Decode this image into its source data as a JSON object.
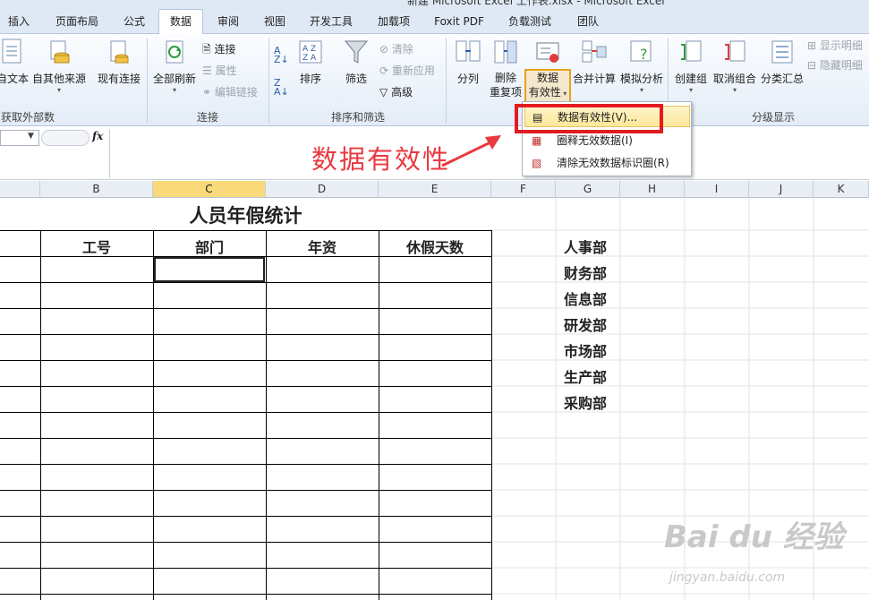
{
  "window": {
    "title": "新建 Microsoft Excel 工作表.xlsx - Microsoft Excel"
  },
  "tabs": [
    {
      "label": "插入"
    },
    {
      "label": "页面布局"
    },
    {
      "label": "公式"
    },
    {
      "label": "数据"
    },
    {
      "label": "审阅"
    },
    {
      "label": "视图"
    },
    {
      "label": "开发工具"
    },
    {
      "label": "加载项"
    },
    {
      "label": "Foxit PDF"
    },
    {
      "label": "负载测试"
    },
    {
      "label": "团队"
    }
  ],
  "ribbon": {
    "get_external": {
      "from_text": "自文本",
      "other_sources": "自其他来源",
      "existing": "现有连接",
      "group": "获取外部数据"
    },
    "connections": {
      "refresh_all": "全部刷新",
      "connections": "连接",
      "properties": "属性",
      "edit_links": "编辑链接",
      "group": "连接"
    },
    "sort_filter": {
      "sort": "排序",
      "filter": "筛选",
      "clear": "清除",
      "reapply": "重新应用",
      "advanced": "高级",
      "group": "排序和筛选"
    },
    "data_tools": {
      "text_to_columns": "分列",
      "remove_duplicates_1": "删除",
      "remove_duplicates_2": "重复项",
      "validation_1": "数据",
      "validation_2": "有效性",
      "consolidate": "合并计算",
      "what_if": "模拟分析"
    },
    "outline": {
      "group_btn": "创建组",
      "ungroup": "取消组合",
      "subtotal": "分类汇总",
      "show_detail": "显示明细",
      "hide_detail": "隐藏明细",
      "group": "分级显示"
    }
  },
  "formula_bar": {
    "fx": "fx",
    "value": ""
  },
  "annotation": {
    "text": "数据有效性"
  },
  "dropdown": {
    "items": [
      {
        "label": "数据有效性(V)..."
      },
      {
        "label": "圈释无效数据(I)"
      },
      {
        "label": "清除无效数据标识圈(R)"
      }
    ]
  },
  "sheet": {
    "columns": [
      "B",
      "C",
      "D",
      "E",
      "F",
      "G",
      "H",
      "I",
      "J",
      "K"
    ],
    "selected_column": "C",
    "table_title": "人员年假统计",
    "headers": [
      "工号",
      "部门",
      "年资",
      "休假天数"
    ],
    "departments": [
      "人事部",
      "财务部",
      "信息部",
      "研发部",
      "市场部",
      "生产部",
      "采购部"
    ]
  },
  "watermark": {
    "brand": "Bai du 经验",
    "url": "jingyan.baidu.com"
  },
  "colors": {
    "accent_red": "#e11b22",
    "selected_header": "#f9d97a",
    "ribbon_bg": "#e3ecf7"
  }
}
